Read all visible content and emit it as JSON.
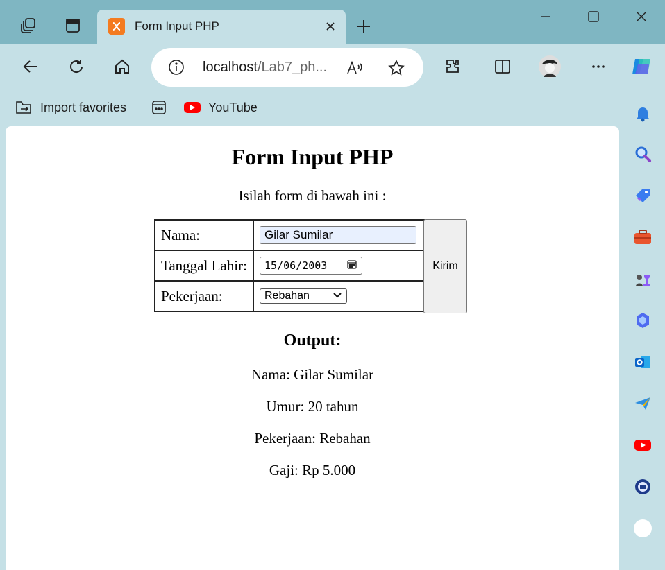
{
  "browser": {
    "tab": {
      "title": "Form Input PHP"
    },
    "address": {
      "host": "localhost",
      "path": "/Lab7_ph..."
    },
    "favorites": [
      {
        "label": "Import favorites"
      },
      {
        "label": ""
      },
      {
        "label": "YouTube"
      }
    ]
  },
  "page": {
    "title": "Form Input PHP",
    "instruction": "Isilah form di bawah ini :",
    "form": {
      "nama_label": "Nama:",
      "nama_value": "Gilar Sumilar",
      "tanggal_label": "Tanggal Lahir:",
      "tanggal_value": "15/06/2003",
      "pekerjaan_label": "Pekerjaan:",
      "pekerjaan_value": "Rebahan",
      "submit_label": "Kirim"
    },
    "output": {
      "heading": "Output:",
      "nama": "Nama: Gilar Sumilar",
      "umur": "Umur: 20 tahun",
      "pekerjaan": "Pekerjaan: Rebahan",
      "gaji": "Gaji: Rp 5.000"
    }
  },
  "sidebar_icons": [
    "bell-icon",
    "search-icon",
    "tag-icon",
    "briefcase-icon",
    "chess-icon",
    "copilot-icon",
    "outlook-icon",
    "send-icon",
    "youtube-icon",
    "app-icon",
    "github-icon"
  ]
}
